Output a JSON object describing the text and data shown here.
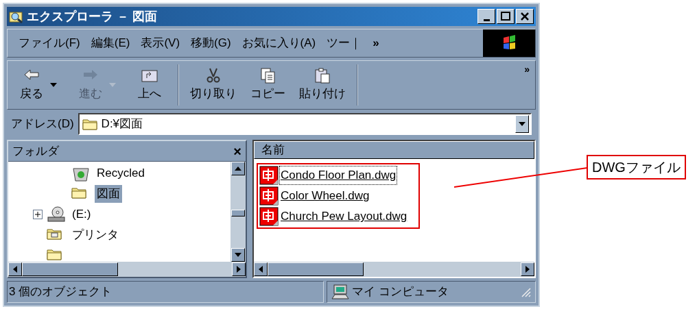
{
  "window": {
    "title": "エクスプローラ － 図面"
  },
  "menu": [
    "ファイル(F)",
    "編集(E)",
    "表示(V)",
    "移動(G)",
    "お気に入り(A)",
    "ツー｜",
    "»"
  ],
  "toolbar": [
    {
      "kind": "back",
      "label": "戻る",
      "disabled": false,
      "dropdown": true
    },
    {
      "kind": "forward",
      "label": "進む",
      "disabled": true,
      "dropdown": true
    },
    {
      "kind": "up",
      "label": "上へ",
      "disabled": false,
      "dropdown": false
    },
    {
      "kind": "cut",
      "label": "切り取り",
      "disabled": false,
      "dropdown": false
    },
    {
      "kind": "copy",
      "label": "コピー",
      "disabled": false,
      "dropdown": false
    },
    {
      "kind": "paste",
      "label": "貼り付け",
      "disabled": false,
      "dropdown": false
    }
  ],
  "toolbar_more": "»",
  "address": {
    "label": "アドレス(D)",
    "value": "D:¥図面"
  },
  "folders": {
    "title": "フォルダ",
    "close": "×",
    "tree": [
      {
        "children": [
          {
            "kind": "recycle-bin",
            "label": "Recycled",
            "selected": false
          },
          {
            "kind": "folder",
            "label": "図面",
            "selected": true
          }
        ]
      },
      {
        "kind": "cd-drive",
        "label": "(E:)",
        "expanded": false,
        "selected": false
      },
      {
        "kind": "printer-folder",
        "label": "プリンタ",
        "selected": false
      },
      {
        "kind": "folder"
      }
    ]
  },
  "files": {
    "column": "名前",
    "items": [
      {
        "name": "Condo Floor Plan.dwg",
        "focused": true
      },
      {
        "name": "Color Wheel.dwg",
        "focused": false
      },
      {
        "name": "Church Pew Layout.dwg",
        "focused": false
      }
    ]
  },
  "status_bar": {
    "count": "3 個のオブジェクト",
    "zone": "マイ コンピュータ"
  },
  "callout": "DWGファイル"
}
